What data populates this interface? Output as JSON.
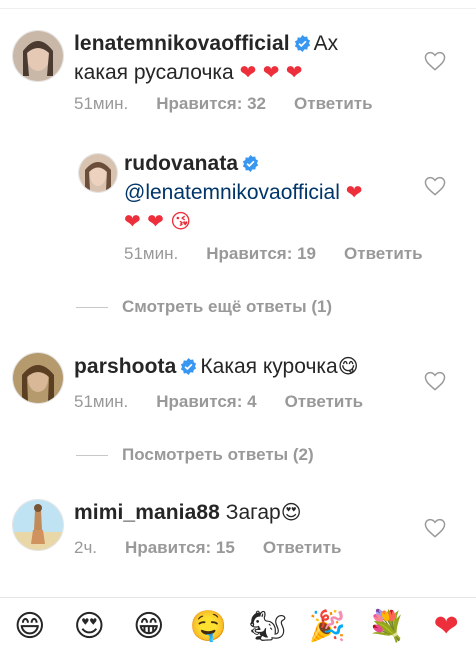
{
  "comments": [
    {
      "username": "lenatemnikovaofficial",
      "verified": true,
      "text": "Ах",
      "text_line2": "какая русалочка",
      "emojis": "❤ ❤ ❤",
      "time": "51мин.",
      "likes": "Нравится: 32",
      "reply": "Ответить"
    },
    {
      "username": "rudovanata",
      "verified": true,
      "mention": "@lenatemnikovaofficial",
      "emojis_line1": "❤",
      "emojis_line2": "❤ ❤ 😘",
      "time": "51мин.",
      "likes": "Нравится: 19",
      "reply": "Ответить"
    },
    {
      "username": "parshoota",
      "verified": true,
      "text": "Какая курочка",
      "emojis": "😋",
      "time": "51мин.",
      "likes": "Нравится: 4",
      "reply": "Ответить"
    },
    {
      "username": "mimi_mania88",
      "verified": false,
      "text": "Загар",
      "emojis": "😍",
      "time": "2ч.",
      "likes": "Нравится: 15",
      "reply": "Ответить"
    }
  ],
  "view_more_replies": "Смотреть ещё ответы (1)",
  "view_replies": "Посмотреть ответы (2)",
  "emoji_bar": [
    "😄",
    "😍",
    "😁",
    "🤤",
    "🐿",
    "🎉",
    "💐",
    "❤"
  ],
  "colors": {
    "text": "#262626",
    "secondary": "#999999",
    "verified": "#3897f0",
    "heart": "#ed2f3c",
    "mention": "#003569"
  }
}
